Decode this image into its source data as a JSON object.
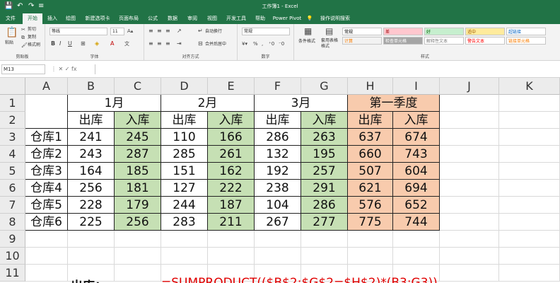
{
  "window": {
    "title": "工作簿1 - Excel",
    "qat": [
      "💾",
      "↶",
      "↷",
      "≡"
    ]
  },
  "tabs": [
    "文件",
    "开始",
    "插入",
    "绘图",
    "新建选项卡",
    "页面布局",
    "公式",
    "数据",
    "审阅",
    "视图",
    "开发工具",
    "帮助",
    "Power Pivot",
    "操作说明搜索"
  ],
  "ribbon": {
    "clipboard": {
      "label": "剪贴板",
      "paste": "粘贴",
      "cut": "剪切",
      "copy": "复制",
      "format_painter": "格式刷"
    },
    "font": {
      "label": "字体",
      "name": "等线",
      "size": "11",
      "bold": "B",
      "italic": "I",
      "underline": "U"
    },
    "alignment": {
      "label": "对齐方式",
      "wrap": "自动换行",
      "merge": "合并后居中"
    },
    "number": {
      "label": "数字",
      "format": "常规"
    },
    "styles_group": {
      "label": "样式",
      "conditional": "条件格式",
      "table": "套用表格格式",
      "styles": [
        {
          "text": "常规",
          "bg": "#ffffff",
          "fg": "#000000"
        },
        {
          "text": "差",
          "bg": "#ffc7ce",
          "fg": "#9c0006"
        },
        {
          "text": "好",
          "bg": "#c6efce",
          "fg": "#006100"
        },
        {
          "text": "适中",
          "bg": "#ffeb9c",
          "fg": "#9c5700"
        },
        {
          "text": "超链接",
          "bg": "#ffffff",
          "fg": "#0563c1"
        },
        {
          "text": "计算",
          "bg": "#f2f2f2",
          "fg": "#fa7d00"
        },
        {
          "text": "检查单元格",
          "bg": "#a5a5a5",
          "fg": "#ffffff"
        },
        {
          "text": "解释性文本",
          "bg": "#ffffff",
          "fg": "#7f7f7f"
        },
        {
          "text": "警告文本",
          "bg": "#ffffff",
          "fg": "#ff0000"
        },
        {
          "text": "链接单元格",
          "bg": "#ffffff",
          "fg": "#fa7d00"
        }
      ]
    }
  },
  "formula_bar": {
    "name_box": "M13",
    "icons": "⋮ ✕ ✓ fx",
    "value": ""
  },
  "columns": [
    "A",
    "B",
    "C",
    "D",
    "E",
    "F",
    "G",
    "H",
    "I",
    "J",
    "K"
  ],
  "rows": [
    "1",
    "2",
    "3",
    "4",
    "5",
    "6",
    "7",
    "8",
    "9",
    "10",
    "11"
  ],
  "months": [
    "1月",
    "2月",
    "3月",
    "第一季度"
  ],
  "subheaders": [
    "出库",
    "入库",
    "出库",
    "入库",
    "出库",
    "入库",
    "出库",
    "入库"
  ],
  "table": [
    {
      "name": "仓库1",
      "values": [
        "241",
        "245",
        "110",
        "166",
        "286",
        "263",
        "637",
        "674"
      ]
    },
    {
      "name": "仓库2",
      "values": [
        "243",
        "287",
        "285",
        "261",
        "132",
        "195",
        "660",
        "743"
      ]
    },
    {
      "name": "仓库3",
      "values": [
        "164",
        "185",
        "151",
        "162",
        "192",
        "257",
        "507",
        "604"
      ]
    },
    {
      "name": "仓库4",
      "values": [
        "256",
        "181",
        "127",
        "222",
        "238",
        "291",
        "621",
        "694"
      ]
    },
    {
      "name": "仓库5",
      "values": [
        "228",
        "179",
        "244",
        "187",
        "104",
        "286",
        "576",
        "652"
      ]
    },
    {
      "name": "仓库6",
      "values": [
        "225",
        "256",
        "283",
        "211",
        "267",
        "277",
        "775",
        "744"
      ]
    }
  ],
  "row11": {
    "label": "出库：",
    "formula": "=SUMPRODUCT(($B$2:$G$2=$H$2)*(B3:G3))"
  },
  "colors": {
    "excel_green": "#217346",
    "in_fill": "#c6e0b4",
    "quarter_fill": "#f8cbad",
    "formula_red": "#e00000"
  }
}
